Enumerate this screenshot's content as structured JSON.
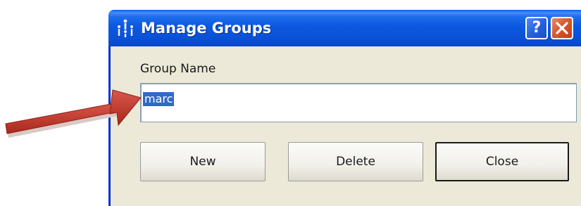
{
  "window": {
    "title": "Manage Groups",
    "help_label": "?",
    "icons": {
      "app": "app-icon",
      "help": "help-icon",
      "close": "close-icon"
    }
  },
  "form": {
    "group_name_label": "Group Name",
    "group_name_value": "marc"
  },
  "buttons": {
    "new_label": "New",
    "delete_label": "Delete",
    "close_label": "Close"
  },
  "annotation": {
    "arrow_icon": "red-arrow-icon",
    "arrow_color": "#c0392b"
  },
  "colors": {
    "titlebar": "#0a52d8",
    "window_bg": "#ece9d8",
    "selection": "#316ac5",
    "close_button": "#d65a2f"
  }
}
